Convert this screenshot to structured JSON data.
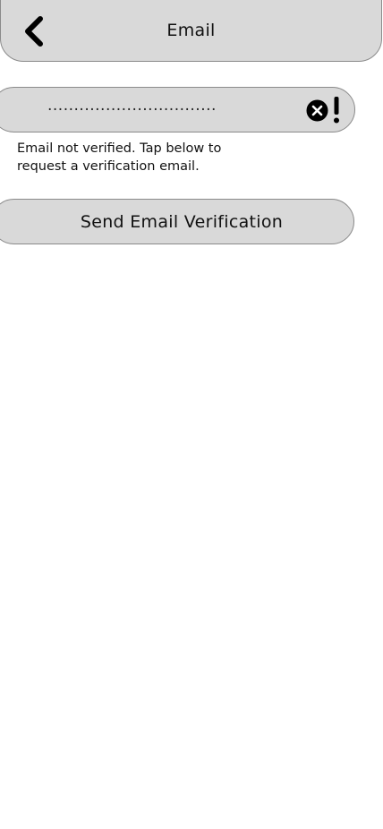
{
  "header": {
    "title": "Email",
    "back_icon": "chevron-left-icon"
  },
  "email_field": {
    "value": "................................",
    "clear_icon": "clear-x-icon",
    "warning_icon": "exclamation-icon"
  },
  "helper": {
    "line1": "Email not verified. Tap below to",
    "line2": "request a verification email."
  },
  "actions": {
    "send_label": "Send Email Verification"
  },
  "colors": {
    "surface": "#d9d9d9",
    "border": "#8a8a8a",
    "text": "#111111",
    "background": "#ffffff"
  }
}
